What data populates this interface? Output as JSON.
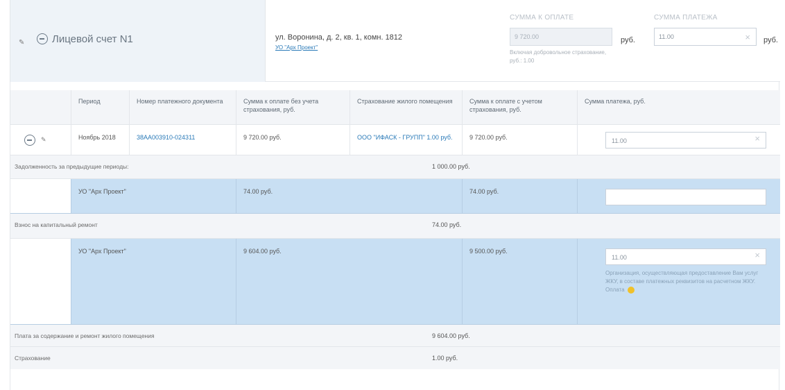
{
  "account": {
    "title": "Лицевой счет N1",
    "edit_icon": "pencil-icon",
    "address": "ул. Воронина, д. 2, кв. 1, комн. 1812",
    "address_link": "УО \"Арх Проект\"",
    "sum_to_pay_label": "СУММА К ОПЛАТЕ",
    "sum_to_pay_value": "9 720.00",
    "sum_to_pay_hint": "Включая добровольное страхование, руб.: 1.00",
    "currency": "руб.",
    "payment_label": "СУММА ПЛАТЕЖА",
    "payment_value": "11.00"
  },
  "table": {
    "headers": [
      "Период",
      "Номер платежного документа",
      "Сумма к оплате без учета страхования, руб.",
      "Страхование жилого помещения",
      "Сумма к оплате с учетом страхования, руб.",
      "Сумма платежа, руб."
    ],
    "row1": {
      "period": "Ноябрь 2018",
      "doc_number": "38АА003910-024311",
      "sum_without_ins": "9 720.00 руб.",
      "insurance": "ООО \"ИФАСК - ГРУПП\" 1.00 руб.",
      "sum_with_ins": "9 720.00 руб.",
      "payment": "11.00"
    },
    "debt_section": {
      "label": "Задолженность за предыдущие периоды:",
      "value": "1 000.00 руб."
    },
    "debt_row": {
      "org": "УО \"Арх Проект\"",
      "sum": "74.00 руб.",
      "sum_with": "74.00 руб.",
      "payment": ""
    },
    "repair_section": {
      "label": "Взнос на капитальный ремонт",
      "value": "74.00 руб."
    },
    "repair_row": {
      "org": "УО \"Арх Проект\"",
      "sum": "9 604.00 руб.",
      "sum_with": "9 500.00 руб.",
      "payment": "11.00",
      "note": "Организация, осуществляющая предоставление Вам услуг ЖКУ, в составе платежных реквизитов на расчетном ЖКУ. Оплата"
    },
    "housing_section": {
      "label": "Плата за содержание и ремонт жилого помещения",
      "value": "9 604.00 руб."
    },
    "insurance_section": {
      "label": "Страхование",
      "value": "1.00 руб."
    }
  }
}
